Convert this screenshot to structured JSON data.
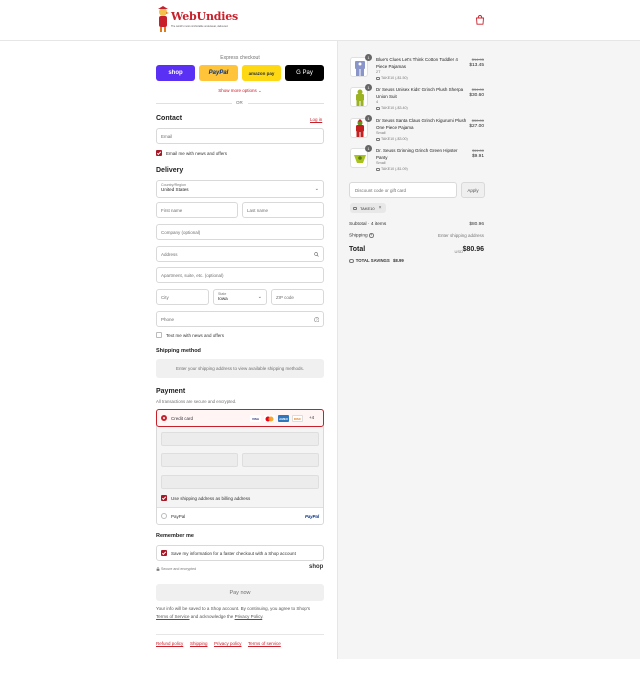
{
  "brand": {
    "name": "WebUndies",
    "tagline": "The world's most comfortable underwear, delivered."
  },
  "express": {
    "title": "Express checkout",
    "buttons": [
      {
        "label": "shop",
        "bg": "#5a31f4",
        "fg": "#ffffff"
      },
      {
        "label": "PayPal",
        "bg": "#ffc439",
        "fg": "#003087"
      },
      {
        "label": "amazon pay",
        "bg": "#ffd814",
        "fg": "#232f3e"
      },
      {
        "label": "G Pay",
        "bg": "#000000",
        "fg": "#ffffff"
      }
    ],
    "show_more": "Show more options",
    "or": "OR"
  },
  "contact": {
    "title": "Contact",
    "login": "Log in",
    "email_placeholder": "Email",
    "email_news": "Email me with news and offers"
  },
  "delivery": {
    "title": "Delivery",
    "country_label": "Country/Region",
    "country_value": "United States",
    "first_name": "First name",
    "last_name": "Last name",
    "company": "Company (optional)",
    "address": "Address",
    "apartment": "Apartment, suite, etc. (optional)",
    "city": "City",
    "state_label": "State",
    "state_value": "Iowa",
    "zip": "ZIP code",
    "phone": "Phone",
    "text_news": "Text me with news and offers"
  },
  "shipping": {
    "title": "Shipping method",
    "message": "Enter your shipping address to view available shipping methods."
  },
  "payment": {
    "title": "Payment",
    "subtitle": "All transactions are secure and encrypted.",
    "credit_card": "Credit card",
    "more_cards": "+4",
    "card_logos": [
      "VISA",
      "MC",
      "AMEX",
      "DISC"
    ],
    "billing_same": "Use shipping address as billing address",
    "paypal": "PayPal"
  },
  "remember": {
    "title": "Remember me",
    "save_info": "Save my information for a faster checkout with a Shop account",
    "secure": "Secure and encrypted",
    "shop": "shop"
  },
  "pay_now": "Pay now",
  "legal": {
    "line1": "Your info will be saved to a Shop account. By continuing, you agree to Shop's",
    "terms": "Terms of Service",
    "and": " and acknowledge the ",
    "privacy": "Privacy Policy",
    "end": "."
  },
  "footer_links": [
    "Refund policy",
    "Shipping",
    "Privacy policy",
    "Terms of service"
  ],
  "cart": {
    "items": [
      {
        "qty": "1",
        "name": "Blue's Clues Let's Think Cotton Toddler 4 Piece Pajamas",
        "variant": "2T",
        "discount": "TAKE10 (-$1.50)",
        "old": "$14.95",
        "price": "$13.45",
        "color": "#8a95c9"
      },
      {
        "qty": "1",
        "name": "Dr Seuss Unisex Kids' Grinch Plush Sherpa Union Suit",
        "variant": "4",
        "discount": "TAKE10 (-$3.40)",
        "old": "$34.00",
        "price": "$30.60",
        "color": "#9bb321"
      },
      {
        "qty": "1",
        "name": "Dr Seuss Santa Claus Grinch Kigurumi Plush One Piece Pajama",
        "variant": "Small",
        "discount": "TAKE10 (-$3.00)",
        "old": "$30.00",
        "price": "$27.00",
        "color": "#c32121"
      },
      {
        "qty": "1",
        "name": "Dr. Seuss Grinning Grinch Green Hipster Panty",
        "variant": "Small",
        "discount": "TAKE10 (-$1.09)",
        "old": "$11.00",
        "price": "$9.91",
        "color": "#a8c21f"
      }
    ],
    "discount_placeholder": "Discount code or gift card",
    "apply": "Apply",
    "code": "TAKE10",
    "subtotal_label": "Subtotal · 4 items",
    "subtotal_value": "$80.96",
    "shipping_label": "Shipping",
    "shipping_value": "Enter shipping address",
    "total_label": "Total",
    "currency": "USD",
    "total_value": "$80.96",
    "savings_label": "TOTAL SAVINGS",
    "savings_value": "$8.99"
  }
}
